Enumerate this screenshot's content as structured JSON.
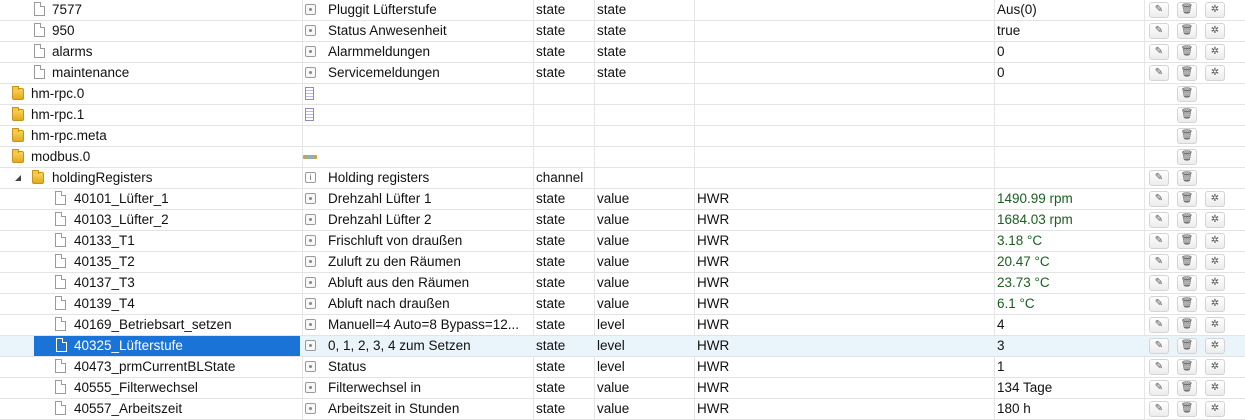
{
  "icons": {
    "edit": "✎",
    "delete": "🗑",
    "settings": "✲",
    "expander": "◢"
  },
  "colors": {
    "selection": "#1a73d6",
    "value_green": "#1b5e20",
    "folder": "#e5a91c"
  },
  "rows": [
    {
      "id": "7577",
      "name": "Pluggit Lüfterstufe",
      "type": "state",
      "role": "state",
      "room": "",
      "value": "Aus(0)"
    },
    {
      "id": "950",
      "name": "Status Anwesenheit",
      "type": "state",
      "role": "state",
      "room": "",
      "value": "true"
    },
    {
      "id": "alarms",
      "name": "Alarmmeldungen",
      "type": "state",
      "role": "state",
      "room": "",
      "value": "0"
    },
    {
      "id": "maintenance",
      "name": "Servicemeldungen",
      "type": "state",
      "role": "state",
      "room": "",
      "value": "0"
    },
    {
      "id": "hm-rpc.0",
      "name": "",
      "type": "",
      "role": "",
      "room": "",
      "value": ""
    },
    {
      "id": "hm-rpc.1",
      "name": "",
      "type": "",
      "role": "",
      "room": "",
      "value": ""
    },
    {
      "id": "hm-rpc.meta",
      "name": "",
      "type": "",
      "role": "",
      "room": "",
      "value": ""
    },
    {
      "id": "modbus.0",
      "name": "",
      "type": "",
      "role": "",
      "room": "",
      "value": ""
    },
    {
      "id": "holdingRegisters",
      "name": "Holding registers",
      "type": "channel",
      "role": "",
      "room": "",
      "value": ""
    },
    {
      "id": "40101_Lüfter_1",
      "name": "Drehzahl Lüfter 1",
      "type": "state",
      "role": "value",
      "room": "HWR",
      "value": "1490.99 rpm"
    },
    {
      "id": "40103_Lüfter_2",
      "name": "Drehzahl Lüfter 2",
      "type": "state",
      "role": "value",
      "room": "HWR",
      "value": "1684.03 rpm"
    },
    {
      "id": "40133_T1",
      "name": "Frischluft von draußen",
      "type": "state",
      "role": "value",
      "room": "HWR",
      "value": "3.18 °C"
    },
    {
      "id": "40135_T2",
      "name": "Zuluft zu den Räumen",
      "type": "state",
      "role": "value",
      "room": "HWR",
      "value": "20.47 °C"
    },
    {
      "id": "40137_T3",
      "name": "Abluft aus den Räumen",
      "type": "state",
      "role": "value",
      "room": "HWR",
      "value": "23.73 °C"
    },
    {
      "id": "40139_T4",
      "name": "Abluft nach draußen",
      "type": "state",
      "role": "value",
      "room": "HWR",
      "value": "6.1 °C"
    },
    {
      "id": "40169_Betriebsart_setzen",
      "name": "Manuell=4 Auto=8 Bypass=12...",
      "type": "state",
      "role": "level",
      "room": "HWR",
      "value": "4"
    },
    {
      "id": "40325_Lüfterstufe",
      "name": "0, 1, 2, 3, 4 zum Setzen",
      "type": "state",
      "role": "level",
      "room": "HWR",
      "value": "3"
    },
    {
      "id": "40473_prmCurrentBLState",
      "name": "Status",
      "type": "state",
      "role": "level",
      "room": "HWR",
      "value": "1"
    },
    {
      "id": "40555_Filterwechsel",
      "name": "Filterwechsel in",
      "type": "state",
      "role": "value",
      "room": "HWR",
      "value": "134 Tage"
    },
    {
      "id": "40557_Arbeitszeit",
      "name": "Arbeitszeit in Stunden",
      "type": "state",
      "role": "value",
      "room": "HWR",
      "value": "180 h"
    }
  ]
}
